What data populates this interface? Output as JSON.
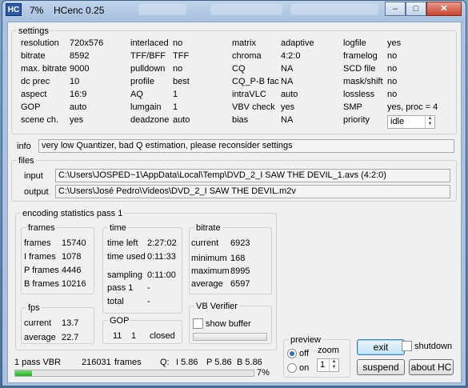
{
  "titlebar": {
    "logo": "HC",
    "percent": "7%",
    "app_name": "HCenc 0.25",
    "minimize": "–",
    "maximize": "□",
    "close": "✕"
  },
  "settings": {
    "legend": "settings",
    "col1": [
      {
        "label": "resolution",
        "value": "720x576"
      },
      {
        "label": "bitrate",
        "value": "8592"
      },
      {
        "label": "max. bitrate",
        "value": "9000"
      },
      {
        "label": "dc prec",
        "value": "10"
      },
      {
        "label": "aspect",
        "value": "16:9"
      },
      {
        "label": "GOP",
        "value": "auto"
      },
      {
        "label": "scene ch.",
        "value": "yes"
      }
    ],
    "col2": [
      {
        "label": "interlaced",
        "value": "no"
      },
      {
        "label": "TFF/BFF",
        "value": "TFF"
      },
      {
        "label": "pulldown",
        "value": "no"
      },
      {
        "label": "profile",
        "value": "best"
      },
      {
        "label": "AQ",
        "value": "1"
      },
      {
        "label": "lumgain",
        "value": "1"
      },
      {
        "label": "deadzone",
        "value": "auto"
      }
    ],
    "col3": [
      {
        "label": "matrix",
        "value": "adaptive"
      },
      {
        "label": "chroma",
        "value": "4:2:0"
      },
      {
        "label": "CQ",
        "value": "NA"
      },
      {
        "label": "CQ_P-B fac",
        "value": "NA"
      },
      {
        "label": "intraVLC",
        "value": "auto"
      },
      {
        "label": "VBV check",
        "value": "yes"
      },
      {
        "label": "bias",
        "value": "NA"
      }
    ],
    "col4": [
      {
        "label": "logfile",
        "value": "yes"
      },
      {
        "label": "framelog",
        "value": "no"
      },
      {
        "label": "SCD file",
        "value": "no"
      },
      {
        "label": "mask/shift",
        "value": "no"
      },
      {
        "label": "lossless",
        "value": "no"
      },
      {
        "label": "SMP",
        "value": "yes,  proc = 4"
      },
      {
        "label": "priority",
        "value": ""
      }
    ],
    "priority_value": "idle"
  },
  "info": {
    "label": "info",
    "message": "very low Quantizer, bad Q estimation, please reconsider settings"
  },
  "files": {
    "legend": "files",
    "input_label": "input",
    "input_value": "C:\\Users\\JOSPED~1\\AppData\\Local\\Temp\\DVD_2_I SAW THE DEVIL_1.avs  (4:2:0)",
    "output_label": "output",
    "output_value": "C:\\Users\\José Pedro\\Videos\\DVD_2_I SAW THE DEVIL.m2v"
  },
  "stats": {
    "legend": "encoding statistics pass 1",
    "frames": {
      "legend": "frames",
      "rows": [
        {
          "label": "frames",
          "value": "15740"
        },
        {
          "label": "I frames",
          "value": "1078"
        },
        {
          "label": "P frames",
          "value": "4446"
        },
        {
          "label": "B frames",
          "value": "10216"
        }
      ]
    },
    "time": {
      "legend": "time",
      "rows": [
        {
          "label": "time left",
          "value": "2:27:02"
        },
        {
          "label": "time used",
          "value": "0:11:33"
        },
        {
          "label": "sampling",
          "value": "0:11:00"
        },
        {
          "label": "pass 1",
          "value": "-"
        },
        {
          "label": "total",
          "value": "-"
        }
      ]
    },
    "bitrate": {
      "legend": "bitrate",
      "rows": [
        {
          "label": "current",
          "value": "6923"
        },
        {
          "label": "minimum",
          "value": "168"
        },
        {
          "label": "maximum",
          "value": "8995"
        },
        {
          "label": "average",
          "value": "6597"
        }
      ]
    },
    "fps": {
      "legend": "fps",
      "rows": [
        {
          "label": "current",
          "value": "13.7"
        },
        {
          "label": "average",
          "value": "22.7"
        }
      ]
    },
    "gop": {
      "legend": "GOP",
      "a": "11",
      "b": "1",
      "c": "closed"
    },
    "vbv": {
      "legend": "VB Verifier",
      "show_buffer": "show buffer"
    }
  },
  "preview": {
    "legend": "preview",
    "zoom_label": "zoom",
    "off_label": "off",
    "on_label": "on",
    "zoom_value": "1",
    "selected": "off"
  },
  "buttons": {
    "exit": "exit",
    "shutdown": "shutdown",
    "suspend": "suspend",
    "about": "about  HC"
  },
  "status": {
    "pass": "1 pass VBR",
    "frames_count": "216031",
    "frames_label": "frames",
    "q_label": "Q:",
    "q_i": "I 5.86",
    "q_p": "P 5.86",
    "q_b": "B 5.86",
    "progress_pct_text": "7%",
    "progress_fraction": 0.07
  },
  "colors": {
    "progress_fill": "#1fae1f",
    "title_bg": "#a9c2df"
  }
}
